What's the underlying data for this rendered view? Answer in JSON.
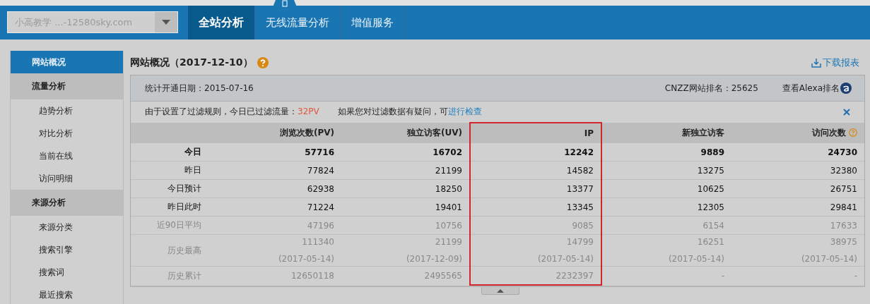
{
  "site_select": {
    "value": "小高教学 ...-12580sky.com"
  },
  "nav_tabs": [
    {
      "label": "全站分析",
      "selected": true
    },
    {
      "label": "无线流量分析",
      "selected": false
    },
    {
      "label": "增值服务",
      "selected": false
    }
  ],
  "sidebar": {
    "items": [
      {
        "label": "网站概况",
        "kind": "link",
        "selected": true
      },
      {
        "label": "流量分析",
        "kind": "group",
        "selected": false
      },
      {
        "label": "趋势分析",
        "kind": "item",
        "selected": false
      },
      {
        "label": "对比分析",
        "kind": "item",
        "selected": false
      },
      {
        "label": "当前在线",
        "kind": "item",
        "selected": false
      },
      {
        "label": "访问明细",
        "kind": "item",
        "selected": false
      },
      {
        "label": "来源分析",
        "kind": "group",
        "selected": false
      },
      {
        "label": "来源分类",
        "kind": "item",
        "selected": false
      },
      {
        "label": "搜索引擎",
        "kind": "item",
        "selected": false
      },
      {
        "label": "搜索词",
        "kind": "item",
        "selected": false
      },
      {
        "label": "最近搜索",
        "kind": "item",
        "selected": false
      }
    ]
  },
  "page": {
    "title": "网站概况（2017-12-10）",
    "download": "下载报表"
  },
  "info_bar": {
    "start_date": "统计开通日期：2015-07-16",
    "rank": "CNZZ网站排名：25625",
    "alexa": "查看Alexa排名"
  },
  "notice": {
    "text": "由于设置了过滤规则，今日已过滤流量：",
    "count": "32PV",
    "question": "如果您对过滤数据有疑问，可",
    "link": "进行检查"
  },
  "table": {
    "columns": [
      {
        "label": "浏览次数(PV)",
        "highlighted": false,
        "help": false
      },
      {
        "label": "独立访客(UV)",
        "highlighted": false,
        "help": false
      },
      {
        "label": "IP",
        "highlighted": true,
        "help": false
      },
      {
        "label": "新独立访客",
        "highlighted": false,
        "help": false
      },
      {
        "label": "访问次数",
        "highlighted": false,
        "help": true
      }
    ],
    "rows": [
      {
        "label": "今日",
        "kind": "strong",
        "cells": [
          {
            "value": "57716"
          },
          {
            "value": "16702"
          },
          {
            "value": "12242"
          },
          {
            "value": "9889"
          },
          {
            "value": "24730"
          }
        ]
      },
      {
        "label": "昨日",
        "kind": "normal",
        "cells": [
          {
            "value": "77824"
          },
          {
            "value": "21199"
          },
          {
            "value": "14582"
          },
          {
            "value": "13275"
          },
          {
            "value": "32380"
          }
        ]
      },
      {
        "label": "今日预计",
        "kind": "normal",
        "cells": [
          {
            "value": "62938"
          },
          {
            "value": "18250"
          },
          {
            "value": "13377"
          },
          {
            "value": "10625"
          },
          {
            "value": "26751"
          }
        ]
      },
      {
        "label": "昨日此时",
        "kind": "normal",
        "cells": [
          {
            "value": "71224"
          },
          {
            "value": "19401"
          },
          {
            "value": "13345"
          },
          {
            "value": "12305"
          },
          {
            "value": "29841"
          }
        ]
      },
      {
        "label": "近90日平均",
        "kind": "muted",
        "cells": [
          {
            "value": "47196"
          },
          {
            "value": "10756"
          },
          {
            "value": "9085"
          },
          {
            "value": "6154"
          },
          {
            "value": "17633"
          }
        ]
      },
      {
        "label": "历史最高",
        "kind": "muted",
        "cells": [
          {
            "value": "111340",
            "date": "(2017-05-14)"
          },
          {
            "value": "21199",
            "date": "(2017-12-09)"
          },
          {
            "value": "14799",
            "date": "(2017-05-14)"
          },
          {
            "value": "16251",
            "date": "(2017-05-14)"
          },
          {
            "value": "38975",
            "date": "(2017-05-14)"
          }
        ]
      },
      {
        "label": "历史累计",
        "kind": "muted",
        "cells": [
          {
            "value": "12650118"
          },
          {
            "value": "2495565"
          },
          {
            "value": "2232397"
          },
          {
            "value": "-"
          },
          {
            "value": "-"
          }
        ]
      }
    ]
  }
}
